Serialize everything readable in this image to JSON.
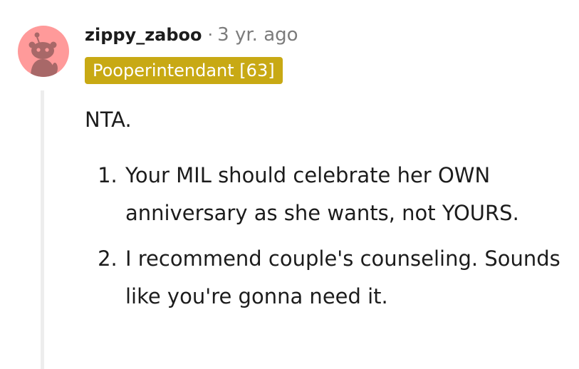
{
  "comment": {
    "username": "zippy_zaboo",
    "separator": "·",
    "timestamp": "3 yr. ago",
    "flair": "Pooperintendant [63]",
    "intro": "NTA.",
    "list_items": [
      "Your MIL should celebrate her OWN anniversary as she wants, not YOURS.",
      "I recommend couple's counseling. Sounds like you're gonna need it."
    ]
  },
  "avatar": {
    "icon": "snoo-avatar-icon",
    "background_color": "#ff9a9a",
    "figure_color": "#a86868"
  },
  "colors": {
    "flair_background": "#c8a914",
    "meta_text": "#7c7c7c",
    "thread_line": "#ededed"
  }
}
